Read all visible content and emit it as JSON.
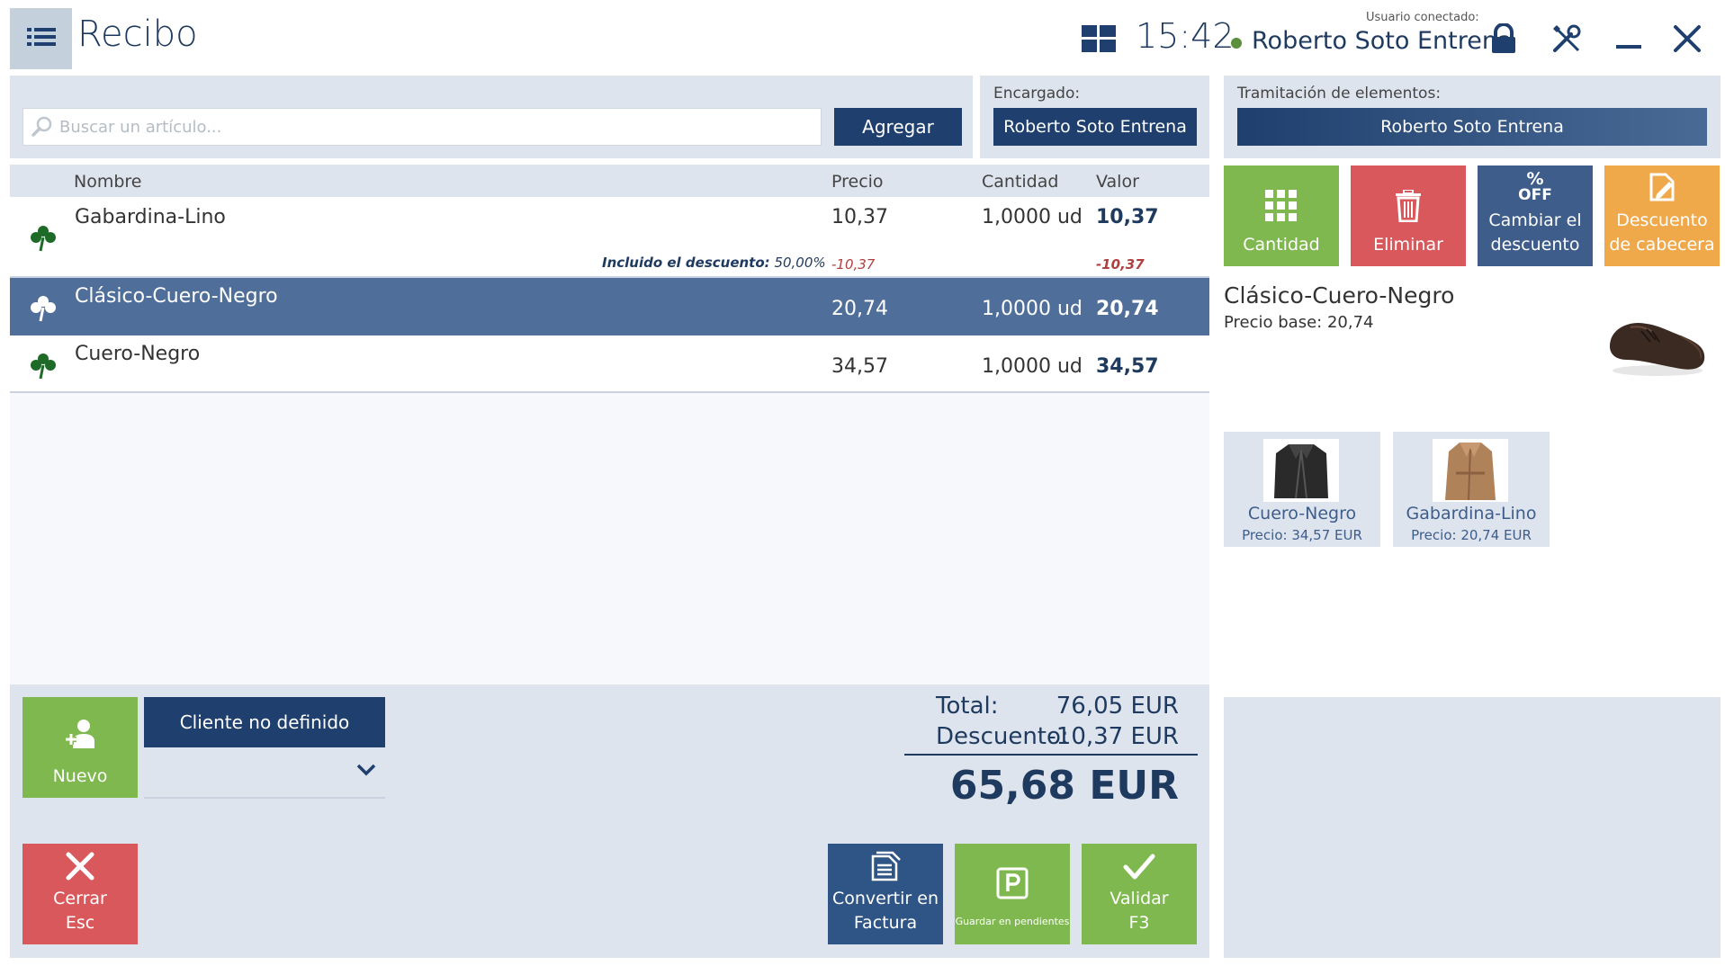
{
  "header": {
    "title": "Recibo",
    "clock": "15:42",
    "user_label": "Usuario conectado:",
    "user_name": "Roberto Soto Entrena"
  },
  "search": {
    "placeholder": "Buscar un artículo...",
    "add_label": "Agregar"
  },
  "assigned": {
    "label": "Encargado:",
    "value": "Roberto Soto Entrena"
  },
  "processing": {
    "label": "Tramitación de elementos:",
    "value": "Roberto Soto Entrena"
  },
  "table": {
    "columns": [
      "Nombre",
      "Precio",
      "Cantidad",
      "Valor"
    ],
    "rows": [
      {
        "name": "Gabardina-Lino",
        "price": "10,37",
        "qty": "1,0000 ud",
        "value": "10,37",
        "discount_label": "Incluido el descuento:",
        "discount_pct": "50,00%",
        "discount_price": "-10,37",
        "discount_value": "-10,37"
      },
      {
        "name": "Clásico-Cuero-Negro",
        "price": "20,74",
        "qty": "1,0000 ud",
        "value": "20,74"
      },
      {
        "name": "Cuero-Negro",
        "price": "34,57",
        "qty": "1,0000 ud",
        "value": "34,57"
      }
    ]
  },
  "actions": {
    "qty": "Cantidad",
    "delete": "Eliminar",
    "change_discount": [
      "Cambiar el",
      "descuento"
    ],
    "header_discount": [
      "Descuento",
      "de cabecera"
    ]
  },
  "product": {
    "name": "Clásico-Cuero-Negro",
    "base_price": "Precio base: 20,74"
  },
  "suggestions": [
    {
      "name": "Cuero-Negro",
      "price": "Precio: 34,57 EUR"
    },
    {
      "name": "Gabardina-Lino",
      "price": "Precio: 20,74 EUR"
    }
  ],
  "customer": {
    "new_label": "Nuevo",
    "client_label": "Cliente no definido"
  },
  "totals": {
    "total_label": "Total:",
    "total_value": "76,05 EUR",
    "discount_label": "Descuento:",
    "discount_value": "-10,37 EUR",
    "grand_total": "65,68 EUR"
  },
  "bottom_buttons": {
    "close": [
      "Cerrar",
      "Esc"
    ],
    "convert": [
      "Convertir en",
      "Factura"
    ],
    "save": "Guardar en pendientes",
    "validate": [
      "Validar",
      "F3"
    ]
  },
  "colors": {
    "primary": "#1f3f6e",
    "green": "#7fb84f",
    "red": "#d9585c",
    "orange": "#f0a94a",
    "selected_row": "#4f6f9a"
  }
}
